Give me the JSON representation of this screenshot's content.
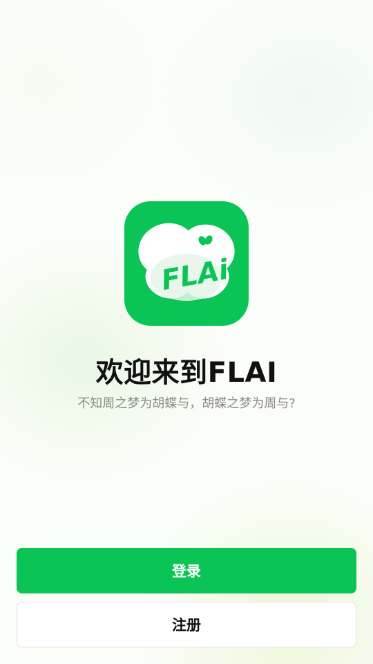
{
  "app": {
    "logo_text": "FLAi",
    "brand_color": "#0ac456",
    "logo_icon": "butterfly-logo-icon"
  },
  "welcome": {
    "title": "欢迎来到FLAI",
    "tagline": "不知周之梦为胡蝶与，胡蝶之梦为周与?"
  },
  "actions": {
    "login_label": "登录",
    "register_label": "注册"
  }
}
